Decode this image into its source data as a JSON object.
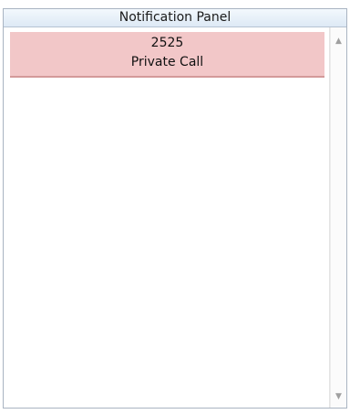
{
  "panel": {
    "title": "Notification Panel"
  },
  "notifications": [
    {
      "number": "2525",
      "type": "Private Call",
      "color": "#f2c7c8"
    }
  ],
  "scrollbar": {
    "up_icon": "▲",
    "down_icon": "▼"
  }
}
